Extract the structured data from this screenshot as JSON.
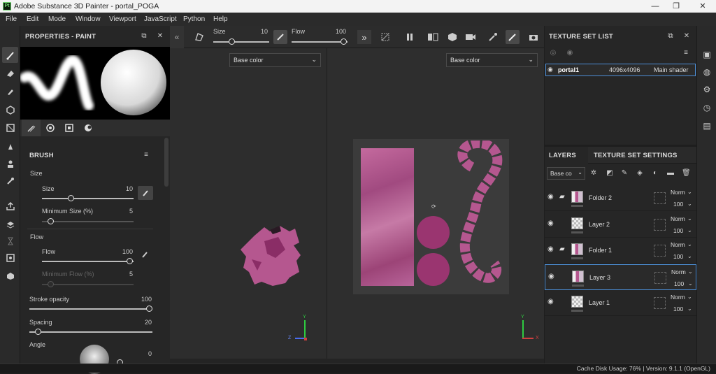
{
  "window": {
    "title": "Adobe Substance 3D Painter - portal_POGA",
    "app_icon": "Pt",
    "minimize": "—",
    "maximize": "❐",
    "close": "✕"
  },
  "menu": [
    "File",
    "Edit",
    "Mode",
    "Window",
    "Viewport",
    "JavaScript",
    "Python",
    "Help"
  ],
  "toolbar": {
    "size_label": "Size",
    "size_value": "10",
    "size_fraction": 0.1,
    "flow_label": "Flow",
    "flow_value": "100",
    "flow_fraction": 1.0
  },
  "properties": {
    "title": "PROPERTIES - PAINT",
    "section_brush": "BRUSH",
    "group_size": "Size",
    "size": {
      "label": "Size",
      "value": "10",
      "fraction": 0.1
    },
    "min_size": {
      "label": "Minimum Size (%)",
      "value": "5",
      "fraction": 0.05
    },
    "group_flow": "Flow",
    "flow": {
      "label": "Flow",
      "value": "100",
      "fraction": 1.0
    },
    "min_flow": {
      "label": "Minimum Flow (%)",
      "value": "5",
      "fraction": 0.05
    },
    "stroke_opacity": {
      "label": "Stroke opacity",
      "value": "100",
      "fraction": 1.0
    },
    "spacing": {
      "label": "Spacing",
      "value": "20",
      "fraction": 0.05
    },
    "angle": {
      "label": "Angle",
      "value": "0"
    }
  },
  "viewport": {
    "left_channel": "Base color",
    "right_channel": "Base color",
    "axis_y": "Y",
    "axis_z": "Z",
    "axis_x": "X"
  },
  "texture_set_list": {
    "title": "TEXTURE SET LIST",
    "row": {
      "name": "portal1",
      "resolution": "4096x4096",
      "shader": "Main shader"
    }
  },
  "layers_panel": {
    "tab_layers": "LAYERS",
    "tab_tss": "TEXTURE SET SETTINGS",
    "channel_dropdown": "Base co",
    "rows": [
      {
        "name": "Folder 2",
        "blend": "Norm",
        "opacity": "100",
        "type": "folder",
        "selected": false
      },
      {
        "name": "Layer 2",
        "blend": "Norm",
        "opacity": "100",
        "type": "layer",
        "selected": false
      },
      {
        "name": "Folder 1",
        "blend": "Norm",
        "opacity": "100",
        "type": "folder",
        "selected": false
      },
      {
        "name": "Layer 3",
        "blend": "Norm",
        "opacity": "100",
        "type": "layer",
        "selected": true
      },
      {
        "name": "Layer 1",
        "blend": "Norm",
        "opacity": "100",
        "type": "layer",
        "selected": false
      }
    ]
  },
  "status": {
    "text": "Cache Disk Usage:   76% | Version: 9.1.1 (OpenGL)"
  },
  "colors": {
    "accent_blue": "#4c8fd8",
    "paint_pink": "#b5578f",
    "paint_dark": "#8a2d66"
  }
}
